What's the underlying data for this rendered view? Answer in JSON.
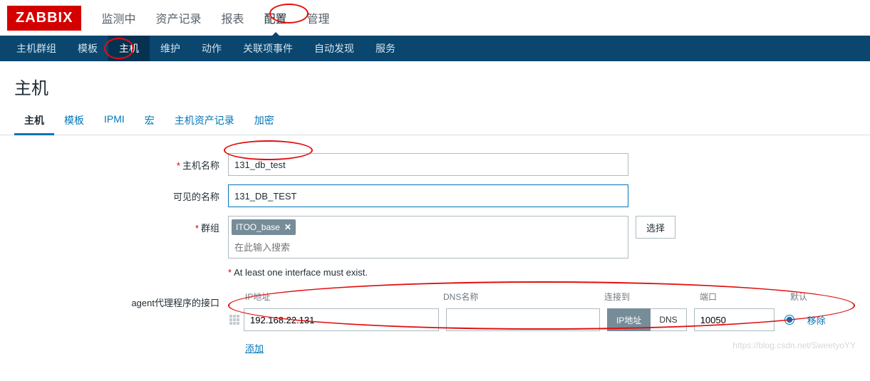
{
  "logo": "ZABBIX",
  "main_nav": {
    "items": [
      "监测中",
      "资产记录",
      "报表",
      "配置",
      "管理"
    ],
    "active": 3
  },
  "sub_nav": {
    "items": [
      "主机群组",
      "模板",
      "主机",
      "维护",
      "动作",
      "关联项事件",
      "自动发现",
      "服务"
    ],
    "active": 2
  },
  "page_title": "主机",
  "tabs": {
    "items": [
      "主机",
      "模板",
      "IPMI",
      "宏",
      "主机资产记录",
      "加密"
    ],
    "active": 0
  },
  "form": {
    "host_name": {
      "label": "主机名称",
      "value": "131_db_test"
    },
    "visible_name": {
      "label": "可见的名称",
      "value": "131_DB_TEST"
    },
    "groups": {
      "label": "群组",
      "tag": "ITOO_base",
      "search_placeholder": "在此输入搜索",
      "select_btn": "选择"
    },
    "interface_hint": "At least one interface must exist.",
    "agent_label": "agent代理程序的接口",
    "iface_headers": {
      "ip": "IP地址",
      "dns": "DNS名称",
      "connect": "连接到",
      "port": "端口",
      "default": "默认"
    },
    "iface_row": {
      "ip": "192.168.22.131",
      "dns": "",
      "conn_ip": "IP地址",
      "conn_dns": "DNS",
      "port": "10050",
      "remove": "移除"
    },
    "add_link": "添加"
  },
  "watermark": "https://blog.csdn.net/SweetyoYY"
}
